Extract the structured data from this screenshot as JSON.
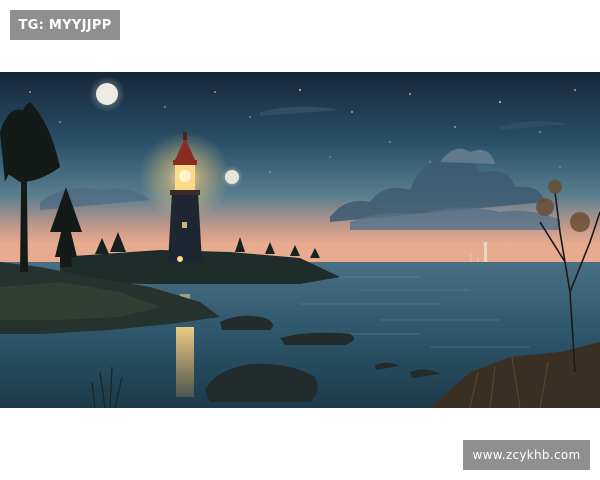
{
  "watermarks": {
    "top_left": "TG: MYYJJPP",
    "bottom_right": "www.zcykhb.com"
  },
  "scene": {
    "subject": "lighthouse-at-night",
    "colors": {
      "sky_top": "#1a2c40",
      "sky_mid": "#3c6a80",
      "horizon": "#e8a890",
      "water": "#2e5a6e",
      "lighthouse_glow": "#ffd27a",
      "lighthouse_red": "#8a2b22",
      "shore": "#1c2420"
    }
  }
}
